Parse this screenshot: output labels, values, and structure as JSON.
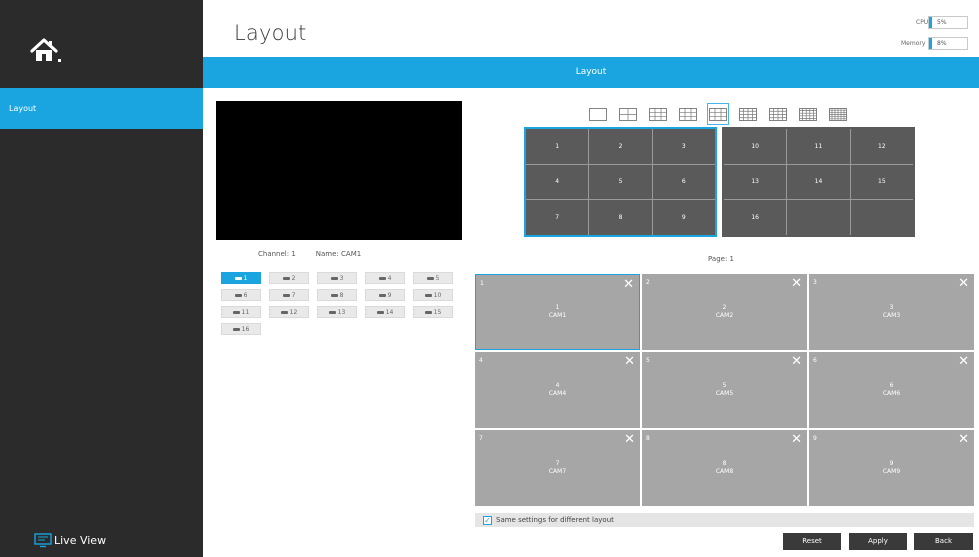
{
  "header": {
    "title": "Layout",
    "cpu_label": "CPU",
    "cpu_value": "5%",
    "memory_label": "Memory",
    "memory_value": "8%"
  },
  "sidebar": {
    "home_icon": "home-icon",
    "items": [
      {
        "label": "Layout"
      }
    ],
    "footer_label": "Live View",
    "footer_icon": "monitor-icon"
  },
  "section_bar": {
    "label": "Layout"
  },
  "preview": {
    "channel_text": "Channel: 1",
    "name_text": "Name: CAM1"
  },
  "cameras": [
    "1",
    "2",
    "3",
    "4",
    "5",
    "6",
    "7",
    "8",
    "9",
    "10",
    "11",
    "12",
    "13",
    "14",
    "15",
    "16"
  ],
  "layout_options": [
    "1",
    "4",
    "6",
    "8",
    "9",
    "13",
    "16",
    "25",
    "36"
  ],
  "pages": [
    [
      "1",
      "2",
      "3",
      "4",
      "5",
      "6",
      "7",
      "8",
      "9"
    ],
    [
      "10",
      "11",
      "12",
      "13",
      "14",
      "15",
      "16",
      "",
      ""
    ]
  ],
  "page_label": "Page: 1",
  "grid": [
    {
      "index": "1",
      "num": "1",
      "cam": "CAM1"
    },
    {
      "index": "2",
      "num": "2",
      "cam": "CAM2"
    },
    {
      "index": "3",
      "num": "3",
      "cam": "CAM3"
    },
    {
      "index": "4",
      "num": "4",
      "cam": "CAM4"
    },
    {
      "index": "5",
      "num": "5",
      "cam": "CAM5"
    },
    {
      "index": "6",
      "num": "6",
      "cam": "CAM6"
    },
    {
      "index": "7",
      "num": "7",
      "cam": "CAM7"
    },
    {
      "index": "8",
      "num": "8",
      "cam": "CAM8"
    },
    {
      "index": "9",
      "num": "9",
      "cam": "CAM9"
    }
  ],
  "same_settings": {
    "label": "Same settings for different layout",
    "checked": true
  },
  "buttons": {
    "reset": "Reset",
    "apply": "Apply",
    "back": "Back"
  },
  "colors": {
    "accent": "#1aa4e0",
    "sidebar": "#2b2b2b",
    "cell": "#a6a6a6",
    "page_cell": "#5a5a5a"
  }
}
